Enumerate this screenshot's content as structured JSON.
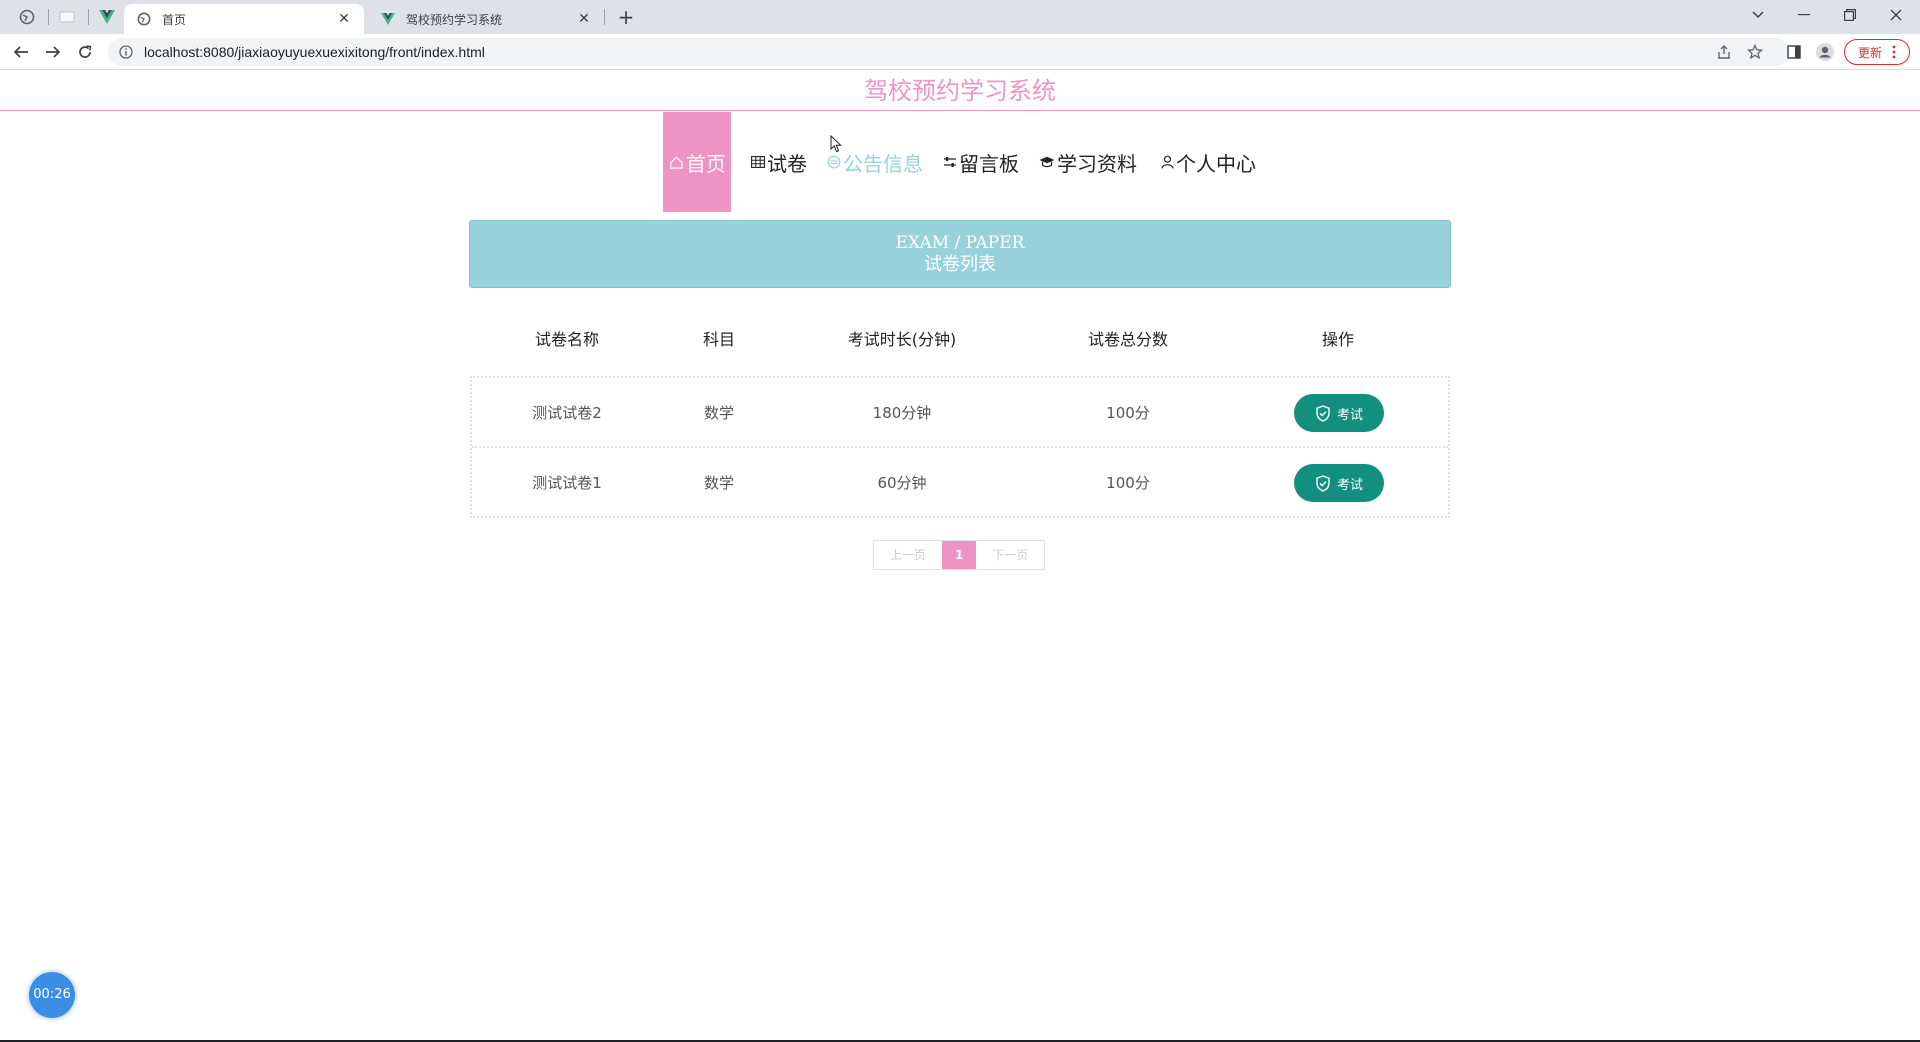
{
  "browser": {
    "tabs": [
      {
        "title": "首页",
        "active": true
      },
      {
        "title": "驾校预约学习系统",
        "active": false
      }
    ],
    "new_tab_label": "+",
    "url": "localhost:8080/jiaxiaoyuyuexuexixitong/front/index.html",
    "update_label": "更新",
    "accent": "#d93025"
  },
  "site": {
    "title": "驾校预约学习系统",
    "brand_color": "#ee93c4"
  },
  "menu": {
    "items": [
      {
        "label": "首页",
        "icon": "home-icon",
        "state": "active"
      },
      {
        "label": "试卷",
        "icon": "grid-icon",
        "state": "normal"
      },
      {
        "label": "公告信息",
        "icon": "notice-icon",
        "state": "hover"
      },
      {
        "label": "留言板",
        "icon": "sliders-icon",
        "state": "normal"
      },
      {
        "label": "学习资料",
        "icon": "graduation-cap-icon",
        "state": "normal"
      },
      {
        "label": "个人中心",
        "icon": "user-icon",
        "state": "normal"
      }
    ]
  },
  "banner": {
    "en": "EXAM / PAPER",
    "zh": "试卷列表",
    "color": "#97d2dc"
  },
  "table": {
    "headers": [
      "试卷名称",
      "科目",
      "考试时长(分钟)",
      "试卷总分数",
      "操作"
    ],
    "rows": [
      {
        "name": "测试试卷2",
        "subject": "数学",
        "duration": "180分钟",
        "score": "100分",
        "action": "考试"
      },
      {
        "name": "测试试卷1",
        "subject": "数学",
        "duration": "60分钟",
        "score": "100分",
        "action": "考试"
      }
    ],
    "button_color": "#138f80"
  },
  "pager": {
    "prev": "上一页",
    "current": "1",
    "next": "下一页"
  },
  "timer": {
    "label": "00:26"
  }
}
